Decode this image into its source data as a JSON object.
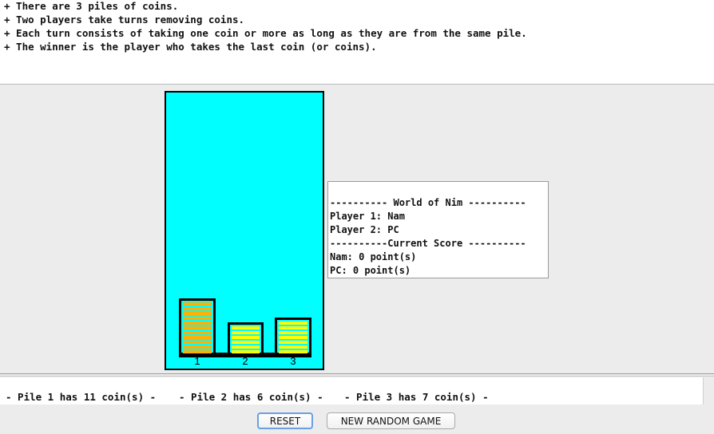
{
  "rules": [
    "+ There are 3 piles of coins.",
    "+ Two players take turns removing coins.",
    "+ Each turn consists of taking one coin or more as long as they are from the same pile.",
    "+ The winner is the player who takes the last coin (or coins)."
  ],
  "colors": {
    "board": "#00ffff",
    "coin_selected": "#ffb000",
    "coin": "#ffff00",
    "coin_edge": "#000000"
  },
  "piles": [
    {
      "number": "1",
      "coins": 11,
      "selected": true
    },
    {
      "number": "2",
      "coins": 6,
      "selected": false
    },
    {
      "number": "3",
      "coins": 7,
      "selected": false
    }
  ],
  "info": {
    "header": "---------- World of Nim ----------",
    "player1": "Player 1: Nam",
    "player2": "Player 2: PC",
    "score_header": "----------Current Score ----------",
    "score1": "Nam: 0 point(s)",
    "score2": "PC: 0 point(s)"
  },
  "status": [
    "- Pile 1 has 11 coin(s) -",
    "- Pile 2 has 6 coin(s) -",
    "- Pile 3 has 7 coin(s) -"
  ],
  "buttons": {
    "reset": "RESET",
    "new_game": "NEW RANDOM GAME"
  }
}
